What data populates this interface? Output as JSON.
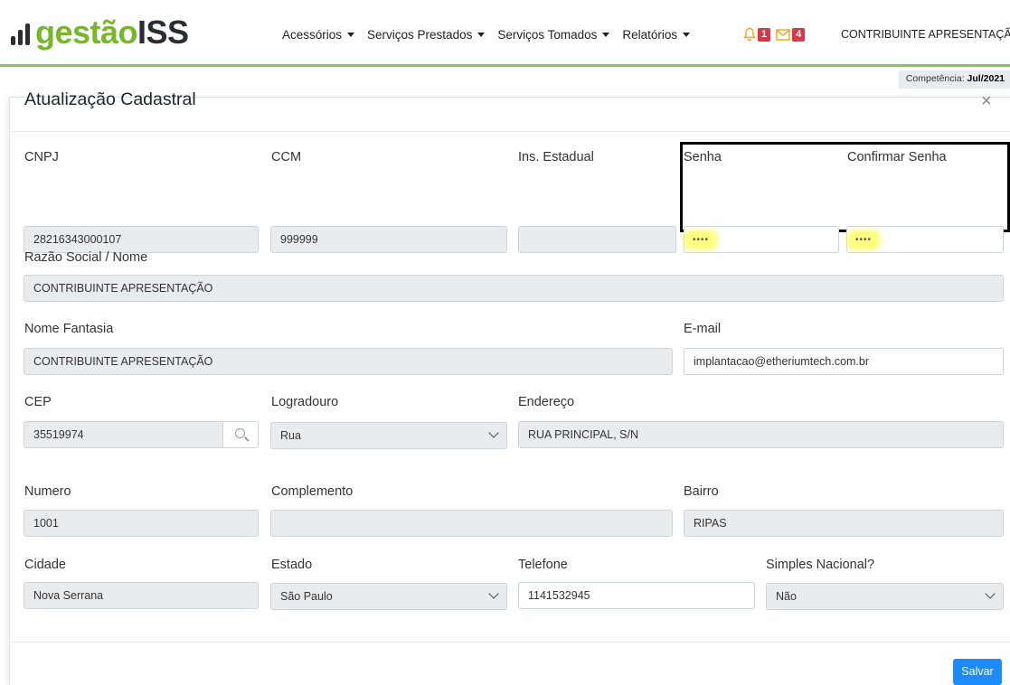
{
  "app": {
    "logo": {
      "part1": "gestão",
      "part2": "ISS"
    }
  },
  "nav": {
    "items": [
      {
        "label": "Acessórios"
      },
      {
        "label": "Serviços Prestados"
      },
      {
        "label": "Serviços Tomados"
      },
      {
        "label": "Relatórios"
      }
    ],
    "notifications_count": "1",
    "messages_count": "4",
    "user": "CONTRIBUINTE APRESENTAÇÃO"
  },
  "competencia": {
    "label": "Competência:",
    "value": "Jul/2021"
  },
  "modal": {
    "title": "Atualização Cadastral",
    "close": "×",
    "save_label": "Salvar"
  },
  "form": {
    "cnpj": {
      "label": "CNPJ",
      "value": "28216343000107"
    },
    "ccm": {
      "label": "CCM",
      "value": "999999"
    },
    "ins_estadual": {
      "label": "Ins. Estadual",
      "value": ""
    },
    "senha": {
      "label": "Senha",
      "value": "••••"
    },
    "confirmar_senha": {
      "label": "Confirmar Senha",
      "value": "••••"
    },
    "razao_social": {
      "label": "Razão Social / Nome",
      "value": "CONTRIBUINTE APRESENTAÇÃO"
    },
    "nome_fantasia": {
      "label": "Nome Fantasia",
      "value": "CONTRIBUINTE APRESENTAÇÃO"
    },
    "email": {
      "label": "E-mail",
      "value": "implantacao@etheriumtech.com.br"
    },
    "cep": {
      "label": "CEP",
      "value": "35519974"
    },
    "logradouro": {
      "label": "Logradouro",
      "value": "Rua"
    },
    "endereco": {
      "label": "Endereço",
      "value": "RUA PRINCIPAL, S/N"
    },
    "numero": {
      "label": "Numero",
      "value": "1001"
    },
    "complemento": {
      "label": "Complemento",
      "value": ""
    },
    "bairro": {
      "label": "Bairro",
      "value": "RIPAS"
    },
    "cidade": {
      "label": "Cidade",
      "value": "Nova Serrana"
    },
    "estado": {
      "label": "Estado",
      "value": "São Paulo"
    },
    "telefone": {
      "label": "Telefone",
      "value": "1141532945"
    },
    "simples_nacional": {
      "label": "Simples Nacional?",
      "value": "Não"
    }
  },
  "colors": {
    "brand_green": "#76b82a",
    "nav_rule": "#8cc44c",
    "badge_red": "#dc3545",
    "primary_button": "#1a8cff",
    "readonly_bg": "#e9ecef",
    "highlight": "#ffff80"
  },
  "icons": {
    "bell": "bell-icon",
    "envelope": "envelope-icon",
    "search": "search-icon",
    "close": "close-icon",
    "chevron": "chevron-down-icon"
  }
}
